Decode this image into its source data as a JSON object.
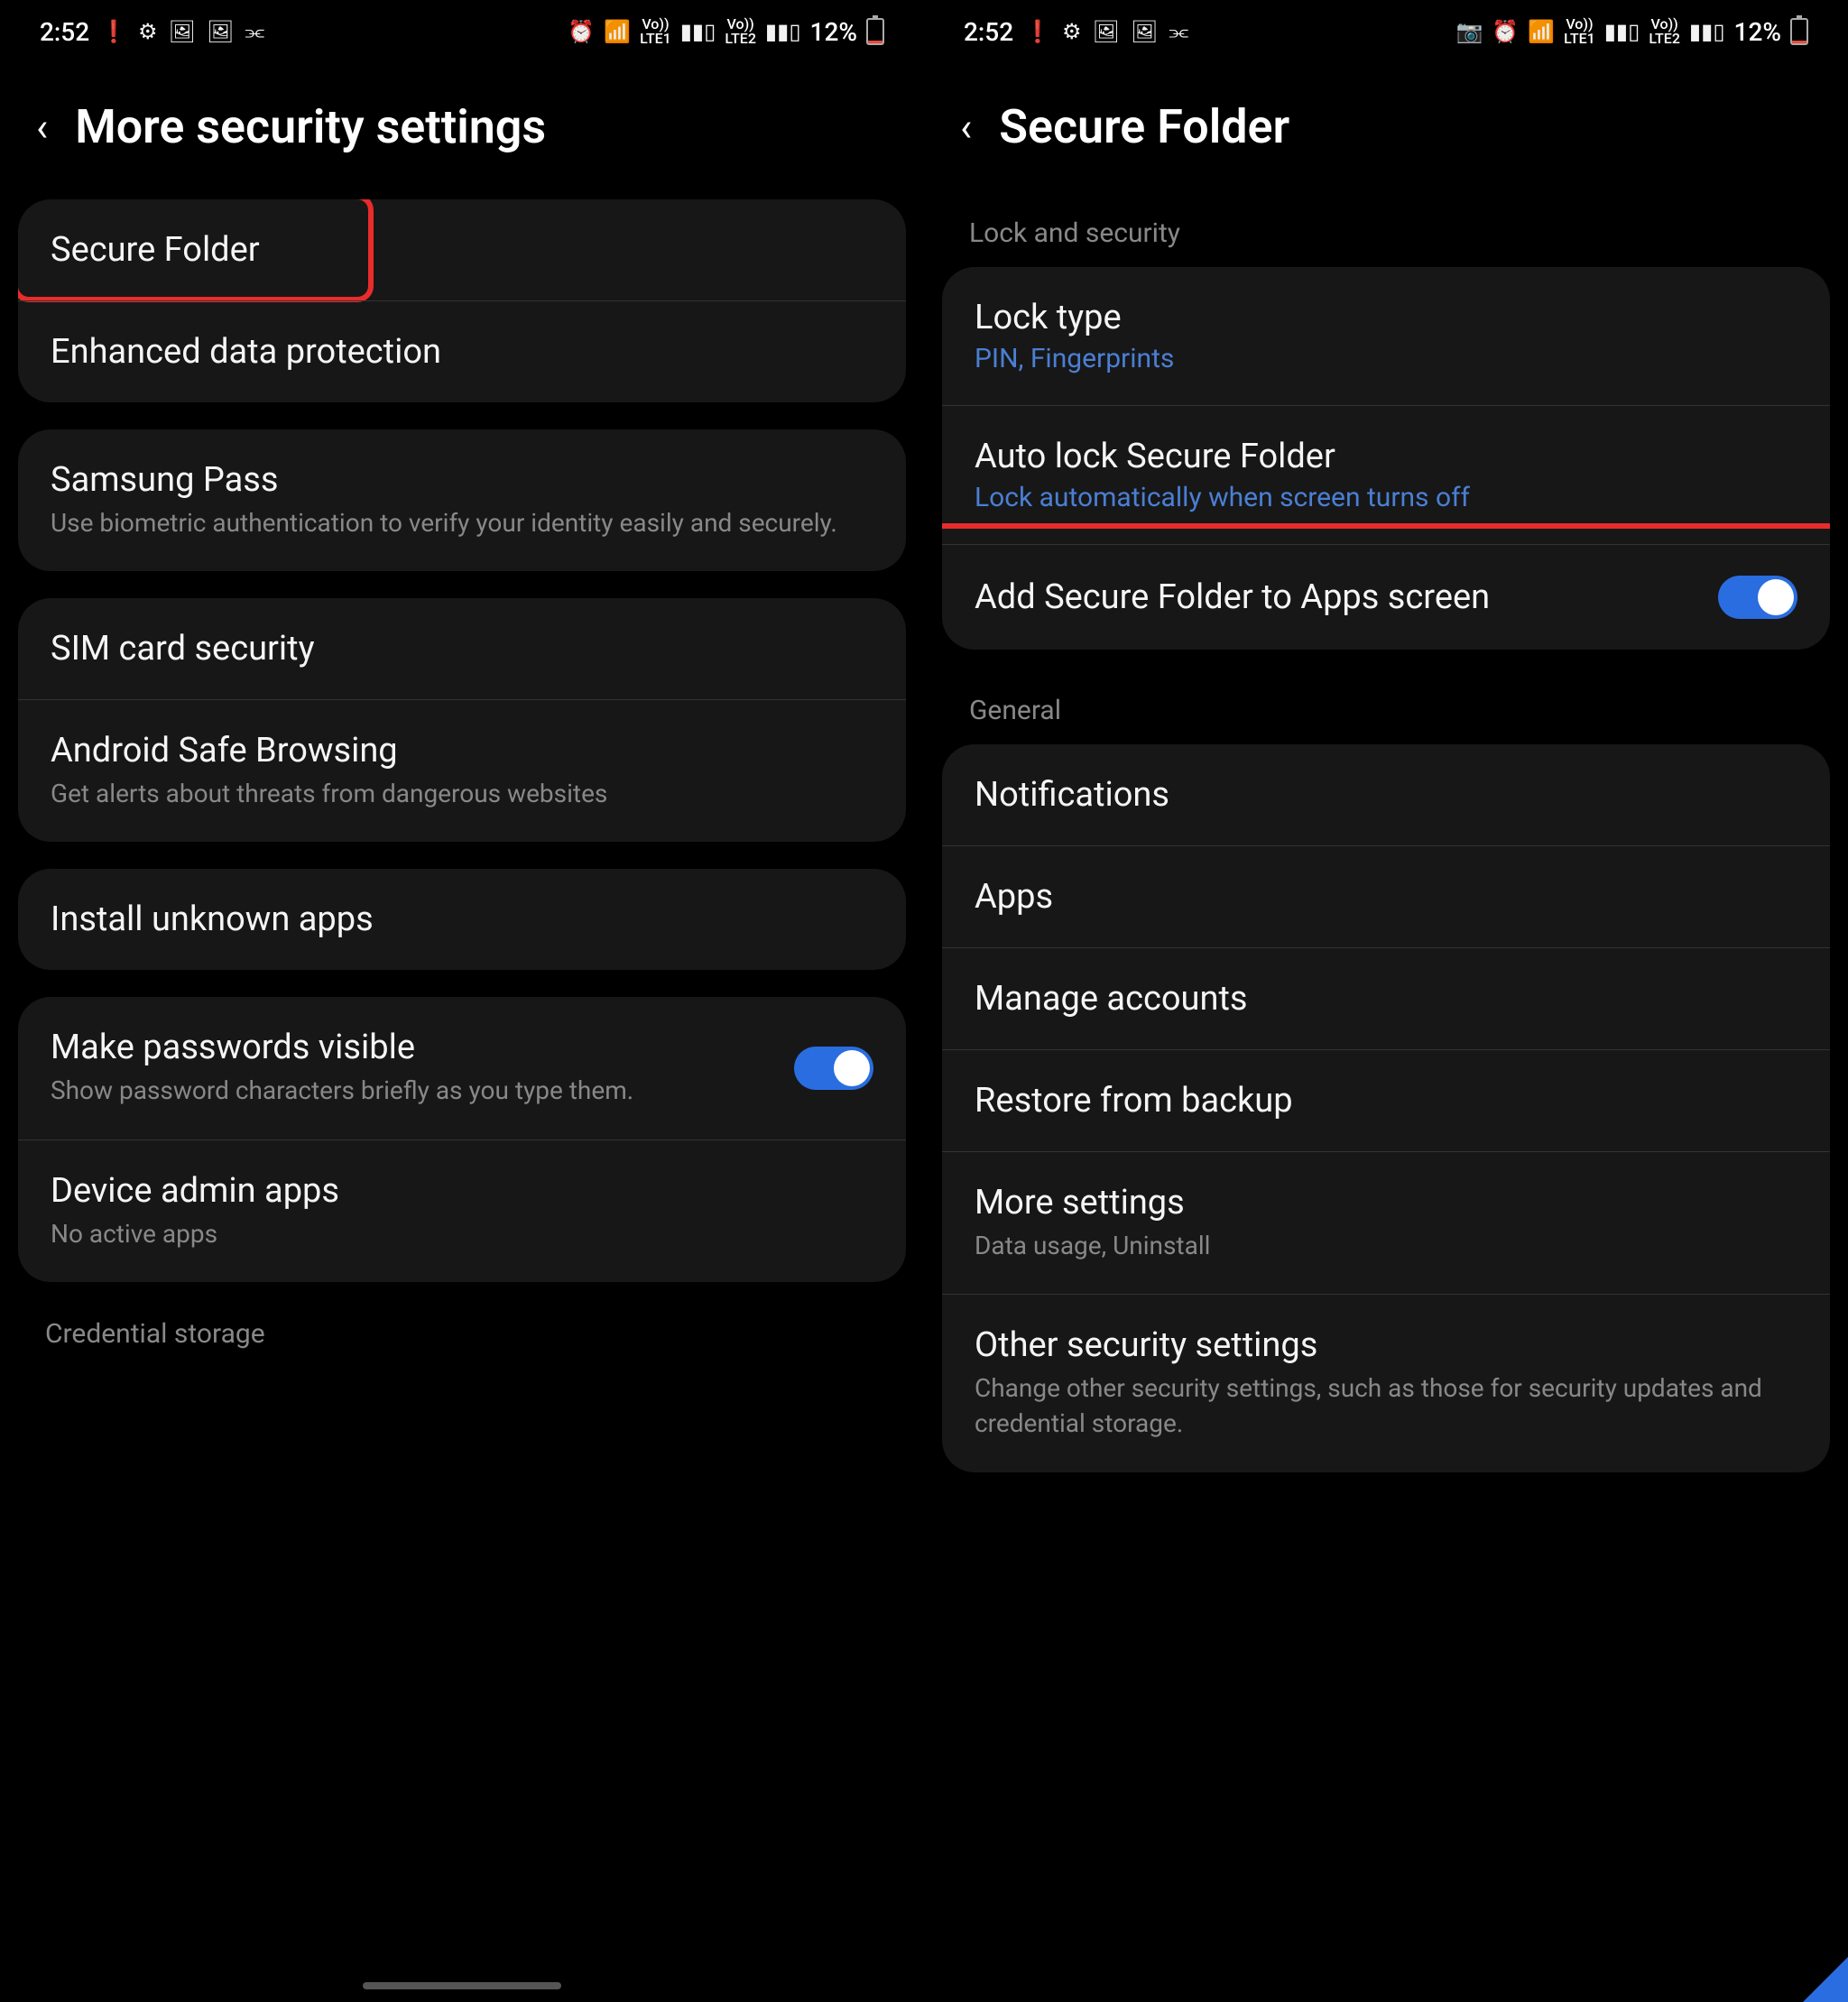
{
  "status": {
    "time": "2:52",
    "battery_pct": "12%"
  },
  "left_screen": {
    "title": "More security settings",
    "group1": {
      "secure_folder": "Secure Folder",
      "enhanced_data": "Enhanced data protection"
    },
    "group2": {
      "samsung_pass": "Samsung Pass",
      "samsung_pass_sub": "Use biometric authentication to verify your identity easily and securely."
    },
    "group3": {
      "sim": "SIM card security",
      "safe_browsing": "Android Safe Browsing",
      "safe_browsing_sub": "Get alerts about threats from dangerous websites"
    },
    "group4": {
      "install_unknown": "Install unknown apps"
    },
    "group5": {
      "passwords_visible": "Make passwords visible",
      "passwords_visible_sub": "Show password characters briefly as you type them.",
      "device_admin": "Device admin apps",
      "device_admin_sub": "No active apps"
    },
    "credential_storage": "Credential storage"
  },
  "right_screen": {
    "title": "Secure Folder",
    "section_lock": "Lock and security",
    "lock_type": "Lock type",
    "lock_type_sub": "PIN, Fingerprints",
    "auto_lock": "Auto lock Secure Folder",
    "auto_lock_sub": "Lock automatically when screen turns off",
    "add_apps": "Add Secure Folder to Apps screen",
    "section_general": "General",
    "notifications": "Notifications",
    "apps": "Apps",
    "manage_accounts": "Manage accounts",
    "restore": "Restore from backup",
    "more_settings": "More settings",
    "more_settings_sub": "Data usage, Uninstall",
    "other_security": "Other security settings",
    "other_security_sub": "Change other security settings, such as those for security updates and credential storage."
  }
}
